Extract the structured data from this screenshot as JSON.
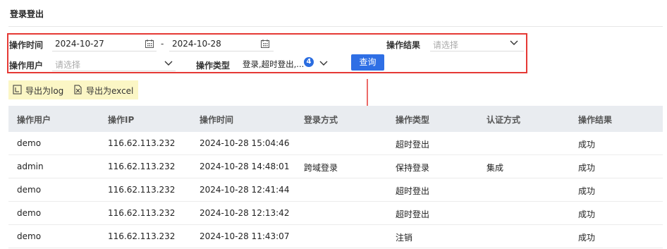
{
  "page": {
    "title": "登录登出"
  },
  "filters": {
    "op_time_label": "操作时间",
    "date_start": "2024-10-27",
    "date_separator": "-",
    "date_end": "2024-10-28",
    "op_result_label": "操作结果",
    "op_result_placeholder": "请选择",
    "op_user_label": "操作用户",
    "op_user_placeholder": "请选择",
    "op_type_label": "操作类型",
    "op_type_value": "登录,超时登出,...",
    "op_type_count": "4",
    "query_button": "查询"
  },
  "export": {
    "log_label": "导出为log",
    "excel_label": "导出为excel"
  },
  "table": {
    "columns": [
      "操作用户",
      "操作IP",
      "操作时间",
      "登录方式",
      "操作类型",
      "认证方式",
      "操作结果"
    ],
    "rows": [
      [
        "demo",
        "116.62.113.232",
        "2024-10-28 15:04:46",
        "",
        "超时登出",
        "",
        "成功"
      ],
      [
        "admin",
        "116.62.113.232",
        "2024-10-28 14:48:01",
        "跨域登录",
        "保持登录",
        "集成",
        "成功"
      ],
      [
        "demo",
        "116.62.113.232",
        "2024-10-28 12:41:44",
        "",
        "超时登出",
        "",
        "成功"
      ],
      [
        "demo",
        "116.62.113.232",
        "2024-10-28 12:13:42",
        "",
        "超时登出",
        "",
        "成功"
      ],
      [
        "demo",
        "116.62.113.232",
        "2024-10-28 11:43:07",
        "",
        "注销",
        "",
        "成功"
      ]
    ]
  },
  "colors": {
    "accent": "#2f6fe5",
    "highlight_border": "#e53935",
    "export_bg": "#fbf6c5"
  }
}
